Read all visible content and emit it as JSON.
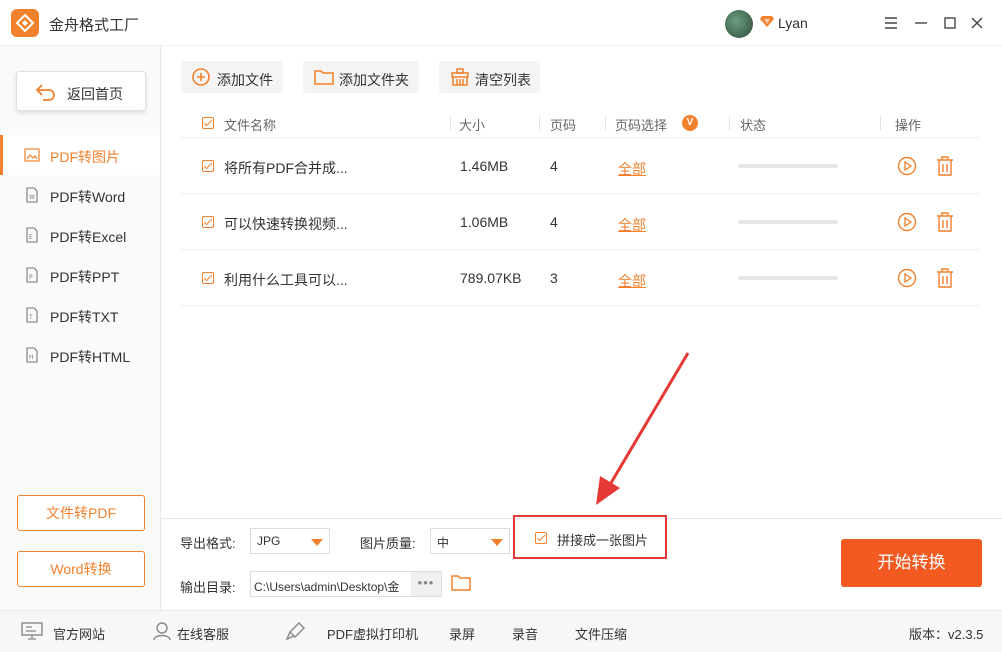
{
  "app": {
    "title": "金舟格式工厂",
    "username": "Lyan",
    "accent": "#f2812d"
  },
  "sidebar": {
    "back_label": "返回首页",
    "items": [
      {
        "label": "PDF转图片",
        "active": true
      },
      {
        "label": "PDF转Word"
      },
      {
        "label": "PDF转Excel"
      },
      {
        "label": "PDF转PPT"
      },
      {
        "label": "PDF转TXT"
      },
      {
        "label": "PDF转HTML"
      }
    ],
    "actions": [
      "文件转PDF",
      "Word转换"
    ]
  },
  "toolbar": {
    "add_file": "添加文件",
    "add_folder": "添加文件夹",
    "clear_list": "清空列表"
  },
  "table": {
    "columns": [
      "文件名称",
      "大小",
      "页码",
      "页码选择",
      "状态",
      "操作"
    ],
    "page_badge": "V",
    "rows": [
      {
        "name": "将所有PDF合并成...",
        "size": "1.46MB",
        "pages": "4",
        "page_sel": "全部"
      },
      {
        "name": "可以快速转换视频...",
        "size": "1.06MB",
        "pages": "4",
        "page_sel": "全部"
      },
      {
        "name": "利用什么工具可以...",
        "size": "789.07KB",
        "pages": "3",
        "page_sel": "全部"
      }
    ]
  },
  "settings": {
    "format_label": "导出格式:",
    "format_value": "JPG",
    "quality_label": "图片质量:",
    "quality_value": "中",
    "merge_label": "拼接成一张图片",
    "output_label": "输出目录:",
    "output_path": "C:\\Users\\admin\\Desktop\\金",
    "more": "•••",
    "start_label": "开始转换"
  },
  "footer": {
    "website": "官方网站",
    "support": "在线客服",
    "printer": "PDF虚拟打印机",
    "screen_rec": "录屏",
    "audio_rec": "录音",
    "compress": "文件压缩",
    "version": "版本：v2.3.5"
  }
}
